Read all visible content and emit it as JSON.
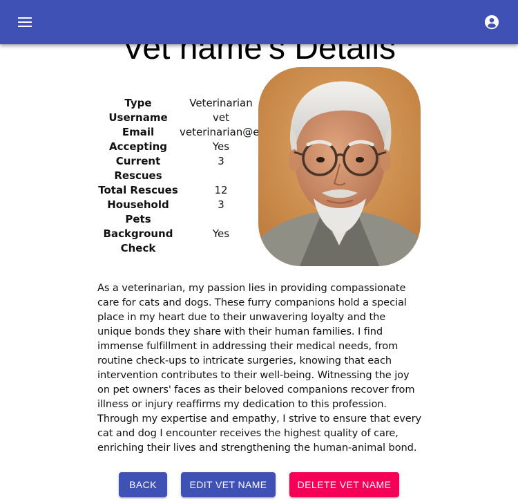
{
  "header": {
    "background_color": "#3f51b5",
    "menu_icon": "hamburger-menu-icon",
    "account_icon": "account-circle-icon"
  },
  "page": {
    "title": "Vet name's Details"
  },
  "details": {
    "type": {
      "label": "Type",
      "value": "Veterinarian"
    },
    "username": {
      "label": "Username",
      "value": "vet"
    },
    "email": {
      "label": "Email",
      "value": "veterinarian@em"
    },
    "accepting": {
      "label": "Accepting",
      "value": "Yes"
    },
    "current_rescues": {
      "label": "Current Rescues",
      "value": "3"
    },
    "total_rescues": {
      "label": "Total Rescues",
      "value": "12"
    },
    "household_pets": {
      "label": "Household Pets",
      "value": "3"
    },
    "background_check": {
      "label": "Background Check",
      "value": "Yes"
    }
  },
  "bio": "As a veterinarian, my passion lies in providing compassionate care for cats and dogs. These furry companions hold a special place in my heart due to their unwavering loyalty and the unique bonds they share with their human families. I find immense fulfillment in addressing their medical needs, from routine check-ups to intricate surgeries, knowing that each intervention contributes to their well-being. Witnessing the joy on pet owners' faces as their beloved companions recover from illness or injury reaffirms my dedication to this profession. Through my expertise and empathy, I strive to ensure that every cat and dog I encounter receives the highest quality of care, enriching their lives and strengthening the human-animal bond.",
  "buttons": {
    "back": "BACK",
    "edit": "EDIT VET NAME",
    "delete": "DELETE VET NAME",
    "primary_color": "#3f51b5",
    "danger_color": "#f50057"
  }
}
